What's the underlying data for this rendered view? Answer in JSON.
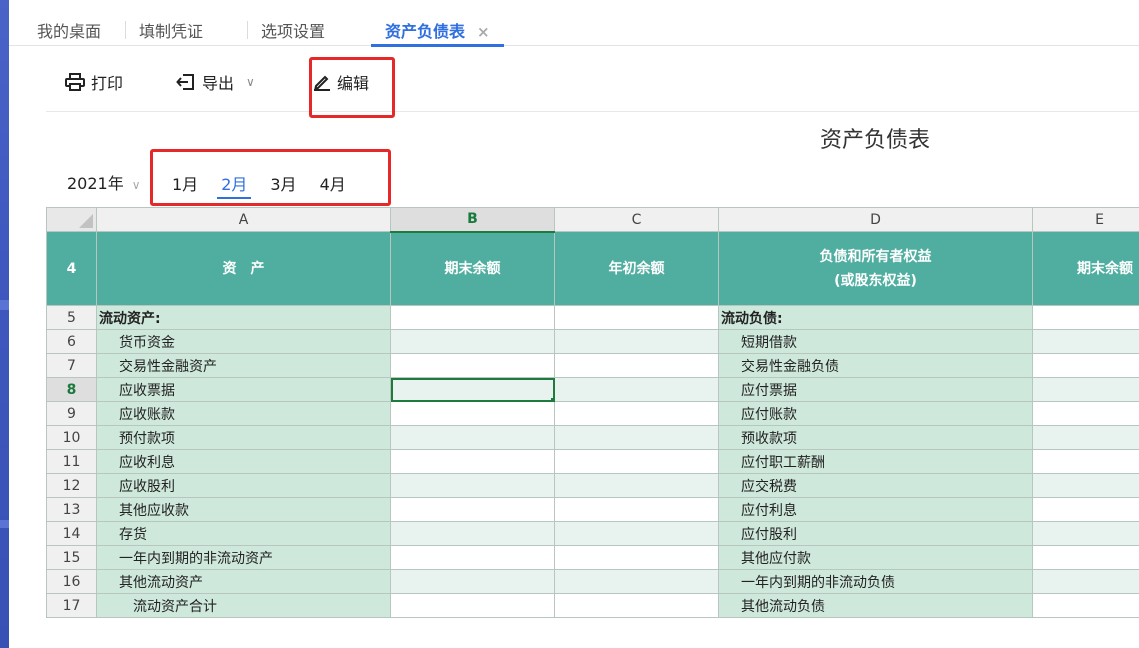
{
  "tabs": [
    {
      "label": "我的桌面",
      "active": false
    },
    {
      "label": "填制凭证",
      "active": false
    },
    {
      "label": "选项设置",
      "active": false
    },
    {
      "label": "资产负债表",
      "active": true,
      "close": "×"
    }
  ],
  "toolbar": {
    "print_label": "打印",
    "export_label": "导出",
    "export_chevron": "∨",
    "edit_label": "编辑"
  },
  "report": {
    "title": "资产负债表"
  },
  "period": {
    "year": "2021年",
    "year_chevron": "∨",
    "months": [
      "1月",
      "2月",
      "3月",
      "4月"
    ],
    "selected_month": "2月"
  },
  "sheet": {
    "columns": [
      "A",
      "B",
      "C",
      "D",
      "E"
    ],
    "selected_column": "B",
    "header_row": {
      "num": "4",
      "a": "资　产",
      "b": "期末余额",
      "c": "年初余额",
      "d_line1": "负债和所有者权益",
      "d_line2": "(或股东权益)",
      "e": "期末余额"
    },
    "rows": [
      {
        "num": "5",
        "a": "流动资产:",
        "d": "流动负债:"
      },
      {
        "num": "6",
        "a": "货币资金",
        "d": "短期借款"
      },
      {
        "num": "7",
        "a": "交易性金融资产",
        "d": "交易性金融负债"
      },
      {
        "num": "8",
        "a": "应收票据",
        "d": "应付票据"
      },
      {
        "num": "9",
        "a": "应收账款",
        "d": "应付账款"
      },
      {
        "num": "10",
        "a": "预付款项",
        "d": "预收款项"
      },
      {
        "num": "11",
        "a": "应收利息",
        "d": "应付职工薪酬"
      },
      {
        "num": "12",
        "a": "应收股利",
        "d": "应交税费"
      },
      {
        "num": "13",
        "a": "其他应收款",
        "d": "应付利息"
      },
      {
        "num": "14",
        "a": "存货",
        "d": "应付股利"
      },
      {
        "num": "15",
        "a": "一年内到期的非流动资产",
        "d": "其他应付款"
      },
      {
        "num": "16",
        "a": "其他流动资产",
        "d": "一年内到期的非流动负债"
      },
      {
        "num": "17",
        "a": "流动资产合计",
        "d": "其他流动负债"
      }
    ],
    "selected_row": "8"
  },
  "colors": {
    "accent": "#2f6fe0",
    "header_teal": "#4faea0",
    "label_green": "#cfe8dc",
    "highlight_red": "#e62828",
    "selection_green": "#1f7a3d"
  }
}
